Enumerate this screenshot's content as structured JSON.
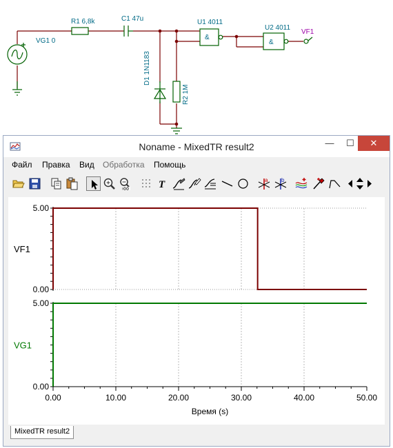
{
  "schematic": {
    "vg1_label": "VG1 0",
    "r1_label": "R1 6,8k",
    "c1_label": "C1 47u",
    "u1_label": "U1 4011",
    "u2_label": "U2 4011",
    "vf1_label": "VF1",
    "d1_label": "D1 1N1183",
    "r2_label": "R2 1M",
    "gate_symbol": "&"
  },
  "window": {
    "title": "Noname - MixedTR result2",
    "minimize_glyph": "—",
    "maximize_glyph": "☐",
    "close_glyph": "✕"
  },
  "menu": [
    "Файл",
    "Правка",
    "Вид",
    "Обработка",
    "Помощь"
  ],
  "toolbar": {
    "icons": [
      "open-icon",
      "save-icon",
      "copy-icon",
      "paste-icon",
      "pointer-icon",
      "zoom-in-icon",
      "zoom-100-icon",
      "grid-icon",
      "text-icon",
      "curve-tool-icon",
      "curve-edit-icon",
      "curve-graph-icon",
      "line-icon",
      "ellipse-icon",
      "cursor-a-icon",
      "cursor-b-icon",
      "waves-icon",
      "probe-icon",
      "step-icon",
      "arrow-left-icon",
      "arrow-updown-icon",
      "arrow-right-icon"
    ],
    "text_glyph": "T",
    "cursor_a": "a",
    "cursor_b": "b"
  },
  "colors": {
    "vf1": "#7b0000",
    "vg1": "#007800",
    "axis": "#000000"
  },
  "chart_data": [
    {
      "type": "line",
      "series": [
        {
          "name": "VF1",
          "x": [
            0,
            0,
            32.6,
            32.6,
            50
          ],
          "y": [
            0,
            5,
            5,
            0,
            0
          ]
        }
      ],
      "ylabel": "VF1",
      "ylim": [
        0,
        5
      ],
      "y_tick_labels": [
        "5.00",
        "0.00"
      ],
      "xlim": [
        0,
        50
      ],
      "grid": true
    },
    {
      "type": "line",
      "series": [
        {
          "name": "VG1",
          "x": [
            0,
            0,
            50
          ],
          "y": [
            0,
            5,
            5
          ]
        }
      ],
      "ylabel": "VG1",
      "ylim": [
        0,
        5
      ],
      "y_tick_labels": [
        "5.00",
        "0.00"
      ],
      "xlim": [
        0,
        50
      ],
      "grid": true,
      "x_tick_labels": [
        "0.00",
        "10.00",
        "20.00",
        "30.00",
        "40.00",
        "50.00"
      ],
      "xlabel": "Время (s)"
    }
  ],
  "tabs": [
    "MixedTR result2"
  ]
}
